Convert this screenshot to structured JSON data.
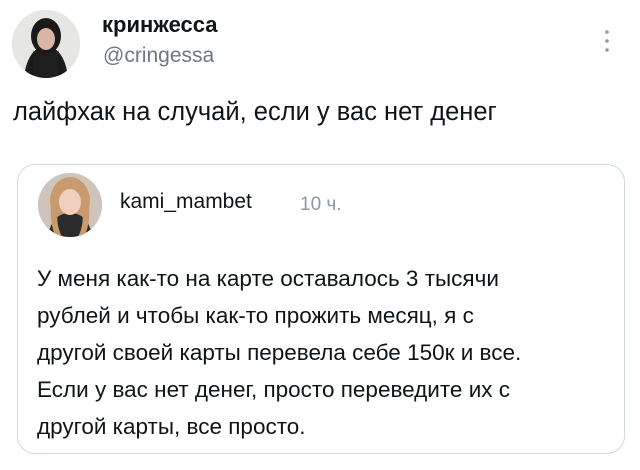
{
  "tweet": {
    "author": {
      "display_name": "кринжесса",
      "handle": "@cringessa",
      "avatar_icon": "user-avatar-photo"
    },
    "more_icon": "vertical-dots-icon",
    "text": "лайфхак на случай, если у вас нет денег"
  },
  "quoted_post": {
    "author_name": "kami_mambet",
    "time": "10 ч.",
    "avatar_icon": "user-avatar-photo",
    "lines": [
      "У меня как-то на карте оставалось 3 тысячи",
      "рублей и чтобы как-то прожить месяц, я с",
      "другой своей карты перевела себе 150к и все.",
      "Если у вас нет денег, просто переведите их с",
      "другой карты, все просто."
    ]
  },
  "colors": {
    "text": "#0f1419",
    "secondary": "#6d7880",
    "border": "#cfd9de"
  }
}
